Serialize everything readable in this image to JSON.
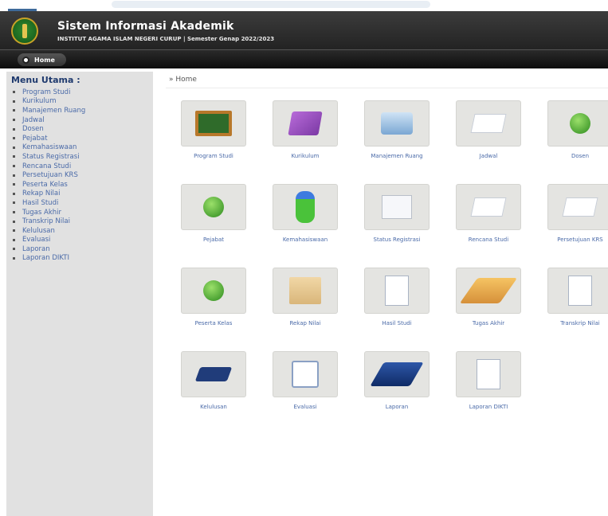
{
  "header": {
    "title": "Sistem Informasi Akademik",
    "subtitle": "INSTITUT AGAMA ISLAM NEGERI CURUP | Semester Genap 2022/2023"
  },
  "nav": {
    "home_label": "Home"
  },
  "sidebar": {
    "title": "Menu Utama :",
    "items": [
      {
        "label": "Program Studi"
      },
      {
        "label": "Kurikulum"
      },
      {
        "label": "Manajemen Ruang"
      },
      {
        "label": "Jadwal"
      },
      {
        "label": "Dosen"
      },
      {
        "label": "Pejabat"
      },
      {
        "label": "Kemahasiswaan"
      },
      {
        "label": "Status Registrasi"
      },
      {
        "label": "Rencana Studi"
      },
      {
        "label": "Persetujuan KRS"
      },
      {
        "label": "Peserta Kelas"
      },
      {
        "label": "Rekap Nilai"
      },
      {
        "label": "Hasil Studi"
      },
      {
        "label": "Tugas Akhir"
      },
      {
        "label": "Transkrip Nilai"
      },
      {
        "label": "Kelulusan"
      },
      {
        "label": "Evaluasi"
      },
      {
        "label": "Laporan"
      },
      {
        "label": "Laporan DIKTI"
      }
    ]
  },
  "breadcrumb": "» Home",
  "modules": [
    {
      "label": "Program Studi",
      "icon": "chalkboard-icon"
    },
    {
      "label": "Kurikulum",
      "icon": "book-icon"
    },
    {
      "label": "Manajemen Ruang",
      "icon": "computer-icon"
    },
    {
      "label": "Jadwal",
      "icon": "paper-icon"
    },
    {
      "label": "Dosen",
      "icon": "teacher-icon"
    },
    {
      "label": "Pejabat",
      "icon": "user-icon"
    },
    {
      "label": "Kemahasiswaan",
      "icon": "student-icon"
    },
    {
      "label": "Status Registrasi",
      "icon": "edit-icon"
    },
    {
      "label": "Rencana Studi",
      "icon": "document-icon"
    },
    {
      "label": "Persetujuan KRS",
      "icon": "document-icon"
    },
    {
      "label": "Peserta Kelas",
      "icon": "user-group-icon"
    },
    {
      "label": "Rekap Nilai",
      "icon": "box-icon"
    },
    {
      "label": "Hasil Studi",
      "icon": "report-icon"
    },
    {
      "label": "Tugas Akhir",
      "icon": "notebook-icon"
    },
    {
      "label": "Transkrip Nilai",
      "icon": "transcript-icon"
    },
    {
      "label": "Kelulusan",
      "icon": "graduation-cap-icon"
    },
    {
      "label": "Evaluasi",
      "icon": "clipboard-icon"
    },
    {
      "label": "Laporan",
      "icon": "blue-book-icon"
    },
    {
      "label": "Laporan DIKTI",
      "icon": "report-doc-icon"
    }
  ]
}
